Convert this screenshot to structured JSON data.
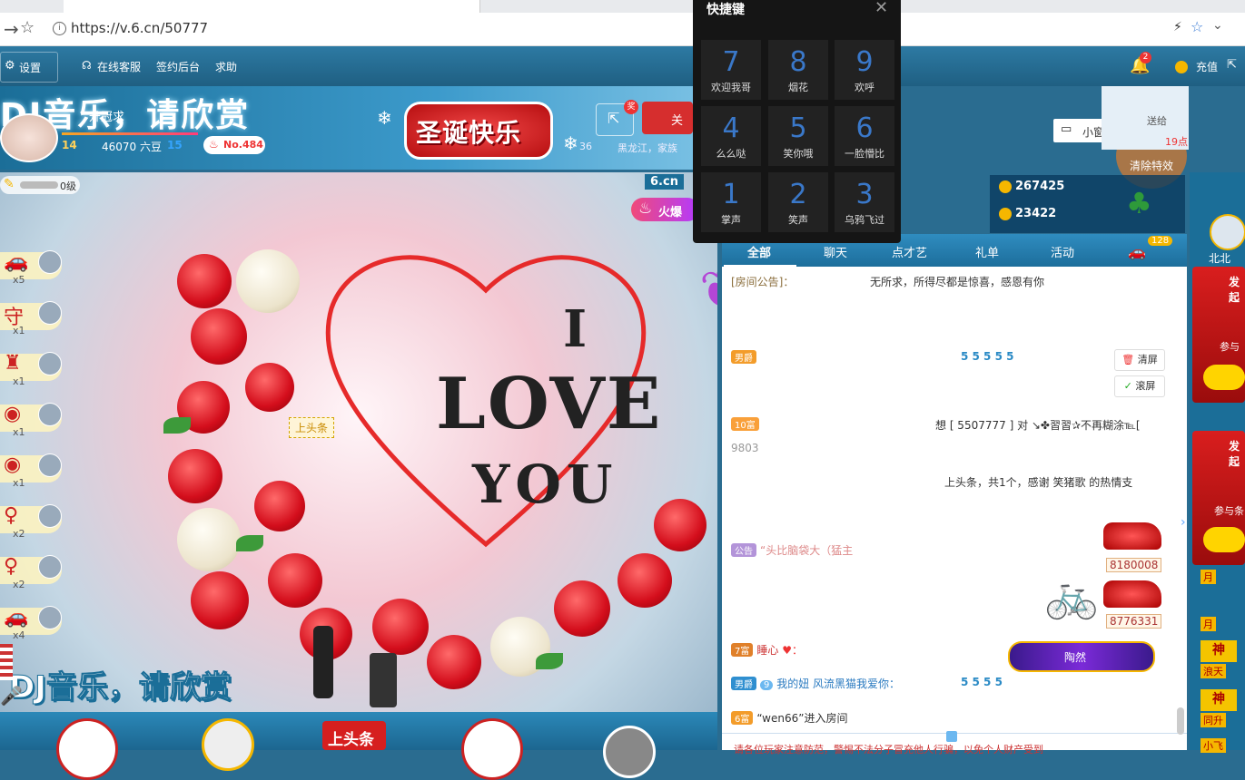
{
  "browser": {
    "url": "https://v.6.cn/50777"
  },
  "nav": {
    "settings": "设置",
    "service": "在线客服",
    "sign": "签约后台",
    "help": "求助",
    "recharge": "充值",
    "notify_count": "2"
  },
  "room": {
    "title": "DJ音乐，请欣赏",
    "subtitle": "升冠求",
    "liudou": "46070 六豆",
    "rank": "No.484",
    "fans": "14",
    "stat2": "15",
    "banner": "圣诞快乐",
    "time": "36",
    "location": "黑龙江，家族",
    "follow_short": "关"
  },
  "video": {
    "level_label": "0级",
    "caption": "DJ音乐，请欣赏",
    "logo": "6.cn",
    "hot": "火爆",
    "headline_top": "上头条",
    "love_i": "I",
    "love_word": "LOVE",
    "love_you": "YOU"
  },
  "gifts": [
    {
      "icon": "car-icon",
      "count": "x5"
    },
    {
      "icon": "shield-icon",
      "count": "x1"
    },
    {
      "icon": "castle-icon",
      "count": "x1"
    },
    {
      "icon": "headphone-icon",
      "count": "x1"
    },
    {
      "icon": "headphone-icon",
      "count": "x1"
    },
    {
      "icon": "girl-icon",
      "count": "x2"
    },
    {
      "icon": "girl-icon",
      "count": "x2"
    },
    {
      "icon": "car-icon",
      "count": "x4"
    }
  ],
  "bottom": {
    "headline": "上头条"
  },
  "shortcut": {
    "title": "快捷键",
    "items": [
      {
        "num": "7",
        "label": "欢迎我哥"
      },
      {
        "num": "8",
        "label": "烟花"
      },
      {
        "num": "9",
        "label": "欢呼"
      },
      {
        "num": "4",
        "label": "么么哒"
      },
      {
        "num": "5",
        "label": "笑你哦"
      },
      {
        "num": "6",
        "label": "一脸懵比"
      },
      {
        "num": "1",
        "label": "掌声"
      },
      {
        "num": "2",
        "label": "笑声"
      },
      {
        "num": "3",
        "label": "乌鸦飞过"
      }
    ]
  },
  "player": {
    "small_window": "小窗口播放",
    "clear_effects": "清除特效",
    "top_right_text": "送给",
    "top_right_text2": "19点"
  },
  "ranks": [
    {
      "value": "267425"
    },
    {
      "value": "23422"
    }
  ],
  "chat": {
    "tabs": [
      "全部",
      "聊天",
      "点才艺",
      "礼单",
      "活动"
    ],
    "car_count": "128",
    "notice_prefix": "[房间公告]：",
    "notice_text": "无所求，所得尽都是惊喜，感恩有你",
    "clear": "清屏",
    "scroll": "滚屏",
    "msg_user_gift": "想 [ 5507777 ] 对 ↘✤習習✰不再糊涂℡[",
    "msg_uid": "9803",
    "msg_headline": "上头条，共1个，感谢 笑猪歌 的热情支",
    "msg_announce": "“头比脑袋大（猛主",
    "msg_love": "睡心",
    "msg_boss": "风流黑猫我爱你：",
    "msg_nick": "我的妞",
    "msg_lvl": "9",
    "msg_enter_user": "“wen66”进入房间",
    "badge_rich": "6富",
    "badge_male": "男爵",
    "badge_rich2": "7富",
    "badge_rich3": "10富",
    "badge_public": "公告",
    "car_price1": "8180008",
    "car_price2": "8776331",
    "vip_button": "陶然",
    "bottom_notice": "请各位玩家注意防范，警惕不法分子冒充他人行骗，以免个人财产受到"
  },
  "right": {
    "north": "北北",
    "items": [
      "发起",
      "参与",
      "发起",
      "参与条"
    ],
    "gods": [
      "神",
      "神"
    ],
    "months": [
      "月",
      "月"
    ],
    "tags": [
      "浪天",
      "同升"
    ],
    "bottom_tag": "小飞"
  }
}
